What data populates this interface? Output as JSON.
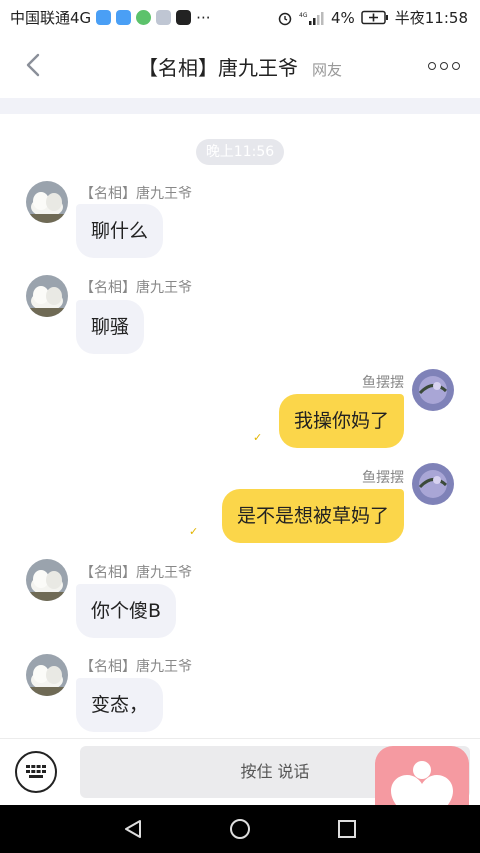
{
  "status_bar": {
    "carrier": "中国联通4G",
    "battery": "4%",
    "time": "半夜11:58",
    "more": "···"
  },
  "header": {
    "title": "【名相】唐九王爷",
    "subtitle": "网友"
  },
  "timestamp": "晚上11:56",
  "messages": [
    {
      "side": "left",
      "nickname": "【名相】唐九王爷",
      "text": "聊什么"
    },
    {
      "side": "left",
      "nickname": "【名相】唐九王爷",
      "text": "聊骚"
    },
    {
      "side": "right",
      "nickname": "鱼摆摆",
      "text": "我操你妈了"
    },
    {
      "side": "right",
      "nickname": "鱼摆摆",
      "text": "是不是想被草妈了"
    },
    {
      "side": "left",
      "nickname": "【名相】唐九王爷",
      "text": "你个傻B"
    },
    {
      "side": "left",
      "nickname": "【名相】唐九王爷",
      "text": "变态，"
    }
  ],
  "input_bar": {
    "hold_to_talk": "按住 说话"
  },
  "colors": {
    "own_bubble": "#fbd64a",
    "other_bubble": "#f1f2f8",
    "float_button": "#f59aa1"
  },
  "icons": [
    "back-arrow-icon",
    "more-dots-icon",
    "keyboard-icon",
    "heart-app-icon",
    "nav-back-icon",
    "nav-home-icon",
    "nav-recents-icon"
  ]
}
